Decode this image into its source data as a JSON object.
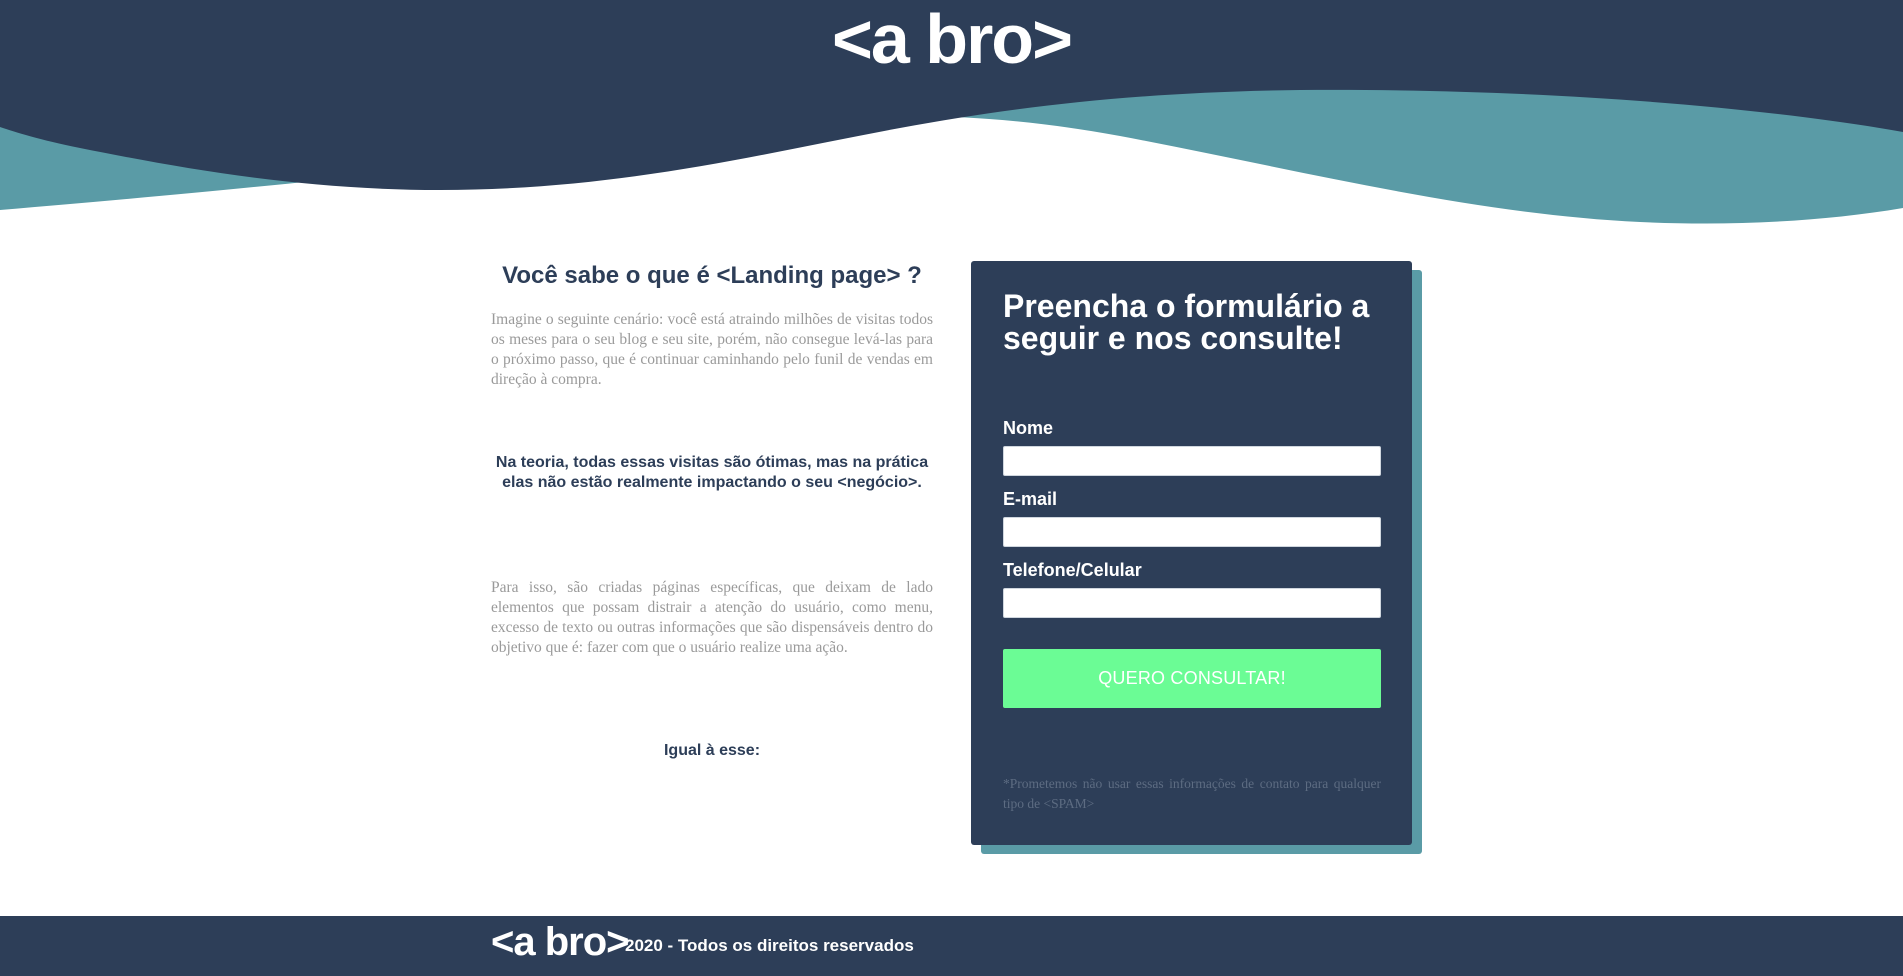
{
  "header": {
    "logo": "<a bro>"
  },
  "intro": {
    "title": "Você sabe o que é <Landing page> ?",
    "paragraph1": "Imagine o seguinte cenário: você está atraindo milhões de visitas todos os meses para o seu blog e seu site, porém, não consegue levá-las para o próximo passo, que é continuar caminhando pelo funil de vendas em direção à compra.",
    "highlight": "Na teoria, todas essas visitas são ótimas, mas na prática elas não estão realmente impactando o seu <negócio>.",
    "paragraph2": "Para isso, são criadas páginas específicas, que deixam de lado elementos que possam distrair a atenção do usuário, como menu, excesso de texto ou outras informações que são dispensáveis dentro do objetivo que é: fazer com que o usuário realize uma ação.",
    "example_label": "Igual à esse:"
  },
  "form": {
    "title": "Preencha o formulário a seguir e nos consulte!",
    "fields": [
      {
        "label": "Nome",
        "value": ""
      },
      {
        "label": "E-mail",
        "value": ""
      },
      {
        "label": "Telefone/Celular",
        "value": ""
      }
    ],
    "submit_label": "QUERO CONSULTAR!",
    "disclaimer": "*Prometemos não usar essas informações de contato para qualquer tipo de <SPAM>"
  },
  "footer": {
    "logo": "<a bro>",
    "copyright": "2020 - Todos os direitos reservados"
  },
  "colors": {
    "navy": "#2d3e58",
    "teal": "#5a9ba6",
    "button_green": "#6bfc95",
    "text_grey": "#9a9a9a"
  }
}
